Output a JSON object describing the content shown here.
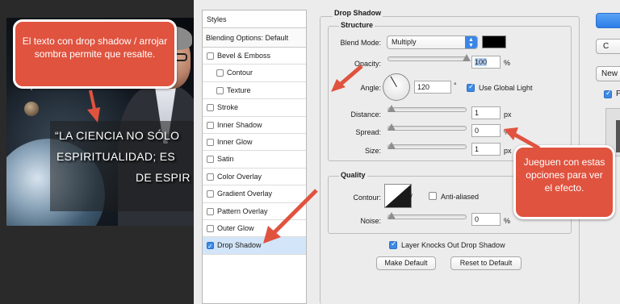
{
  "canvas": {
    "quote_lines": [
      "“LA CIENCIA NO SÓLO",
      "ESPIRITUALIDAD; ES",
      "DE ESPIR"
    ],
    "callout_top": "El texto con drop shadow / arrojar sombra permite que resalte.",
    "callout_right": "Jueguen con estas opciones para ver el efecto."
  },
  "styles_list": {
    "header": "Styles",
    "blending": "Blending Options: Default",
    "items": [
      {
        "label": "Bevel & Emboss"
      },
      {
        "label": "Contour"
      },
      {
        "label": "Texture"
      },
      {
        "label": "Stroke"
      },
      {
        "label": "Inner Shadow"
      },
      {
        "label": "Inner Glow"
      },
      {
        "label": "Satin"
      },
      {
        "label": "Color Overlay"
      },
      {
        "label": "Gradient Overlay"
      },
      {
        "label": "Pattern Overlay"
      },
      {
        "label": "Outer Glow"
      },
      {
        "label": "Drop Shadow"
      }
    ]
  },
  "drop_shadow": {
    "title": "Drop Shadow",
    "structure_title": "Structure",
    "blend_mode_label": "Blend Mode:",
    "blend_mode_value": "Multiply",
    "shadow_color": "#000000",
    "opacity_label": "Opacity:",
    "opacity_value": "100",
    "opacity_unit": "%",
    "opacity_level": 1.0,
    "angle_label": "Angle:",
    "angle_value": "120",
    "angle_unit": "°",
    "global_light_label": "Use Global Light",
    "distance_label": "Distance:",
    "distance_value": "1",
    "distance_unit": "px",
    "spread_label": "Spread:",
    "spread_value": "0",
    "spread_unit": "%",
    "size_label": "Size:",
    "size_value": "1",
    "size_unit": "px",
    "quality_title": "Quality",
    "contour_label": "Contour:",
    "anti_aliased_label": "Anti-aliased",
    "noise_label": "Noise:",
    "noise_value": "0",
    "noise_unit": "%",
    "layer_knocks_label": "Layer Knocks Out Drop Shadow",
    "make_default_label": "Make Default",
    "reset_default_label": "Reset to Default"
  },
  "right_panel": {
    "cancel_label": "C",
    "new_style_label": "New",
    "preview_label": "P"
  },
  "colors": {
    "callout": "#e0533f",
    "accent": "#3d8ae5"
  }
}
